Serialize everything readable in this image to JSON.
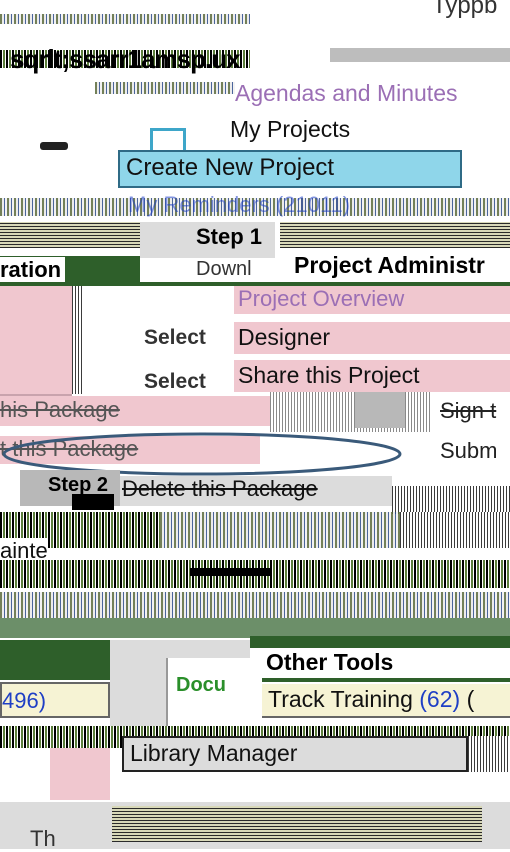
{
  "top": {
    "username_fragment": "Typpb",
    "header_fragment": "sqrlt;ssarr1amsp.ux",
    "agendas_label": "Agendas and Minutes",
    "my_projects_label": "My Projects",
    "create_project_label": "Create New Project",
    "my_reminders_label": "My Reminders (21011)"
  },
  "project_admin": {
    "step1_label": "Step 1",
    "download_fragment": "Downl",
    "heading": "Project Administr",
    "heading_left": "ration",
    "items": [
      {
        "label": "Project Overview"
      },
      {
        "label": "Designer"
      },
      {
        "label": "Share this Project"
      }
    ],
    "select_label": "Select",
    "select_label_2": "Select"
  },
  "package": {
    "this_package_1": "his Package",
    "this_package_2": "t this Package",
    "sign_fragment": "Sign t",
    "submit_fragment": "Subm",
    "step2_label": "Step 2",
    "delete_package": "Delete this Package",
    "maintenance_fragment": "ainte"
  },
  "other_tools": {
    "heading": "Other Tools",
    "track_training": "Track Training",
    "track_training_count": "(62)",
    "track_training_suffix": "(",
    "count_left": "496)",
    "docu_fragment": "Docu",
    "library_manager": "Library Manager",
    "bottom_fragment": "Th"
  },
  "colors": {
    "pink": "#f0c7cf",
    "blue_bar": "#8fd6ea",
    "dark_green": "#2e5f2a",
    "link_blue": "#1f3fc5",
    "highlight_ellipse": "#3a5a7a"
  }
}
